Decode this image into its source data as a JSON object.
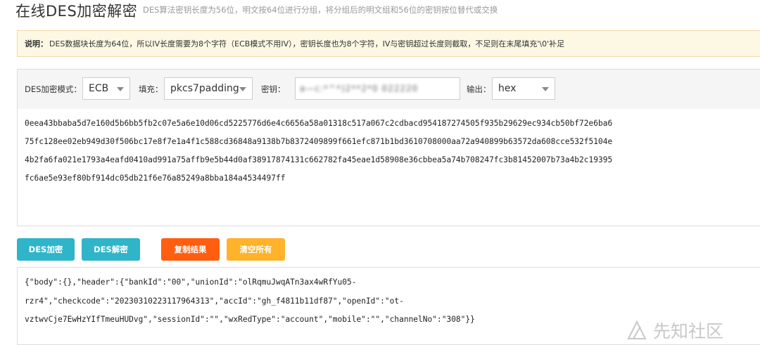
{
  "header": {
    "title": "在线DES加密解密",
    "subtitle": "DES算法密钥长度为56位，明文按64位进行分组，将分组后的明文组和56位的密钥按位替代或交换"
  },
  "notice": {
    "label": "说明：",
    "text": "DES数据块长度为64位，所以IV长度需要为8个字符（ECB模式不用IV），密钥长度也为8个字符，IV与密钥超过长度则截取，不足则在末尾填充'\\0'补足"
  },
  "toolbar": {
    "mode_label": "DES加密模式：",
    "mode_value": "ECB",
    "padding_label": "填充：",
    "padding_value": "pkcs7padding",
    "key_label": "密钥：",
    "key_value": "a—c:*^*)2**2*0 022220",
    "output_label": "输出：",
    "output_value": "hex"
  },
  "output_text": {
    "lines": [
      "0eea43bbaba5d7e160d5b6bb5fb2c07e5a6e10d06cd5225776d6e4c6656a58a01318c517a067c2cdbacd954187274505f935b29629ec934cb50bf72e6ba6",
      "75fc128ee02eb949d30f506bc17e8f7e1a4f1c588cd36848a9138b7b8372409899f661efc871b1bd3610708000aa72a940899b63572da608cce532f5104e",
      "4b2fa6fa021e1793a4eafd0410ad991a75affb9e5b44d0af38917874131c662782fa45eae1d58908e36cbbea5a74b708247fc3b81452007b73a4b2c19395",
      "fc6ae5e93ef80bf914dc05db21f6e76a85249a8bba184a4534497ff"
    ]
  },
  "buttons": {
    "encrypt": "DES加密",
    "decrypt": "DES解密",
    "copy": "复制结果",
    "clear": "清空所有"
  },
  "result_text": {
    "lines": [
      "{\"body\":{},\"header\":{\"bankId\":\"00\",\"unionId\":\"olRqmuJwqATn3ax4wRfYu05-",
      "rzr4\",\"checkcode\":\"20230310223117964313\",\"accId\":\"gh_f4811b11df87\",\"openId\":\"ot-",
      "vztwvCje7EwHzYIfTmeuHUDvg\",\"sessionId\":\"\",\"wxRedType\":\"account\",\"mobile\":\"\",\"channelNo\":\"308\"}}"
    ]
  },
  "watermark": {
    "text": "先知社区"
  }
}
